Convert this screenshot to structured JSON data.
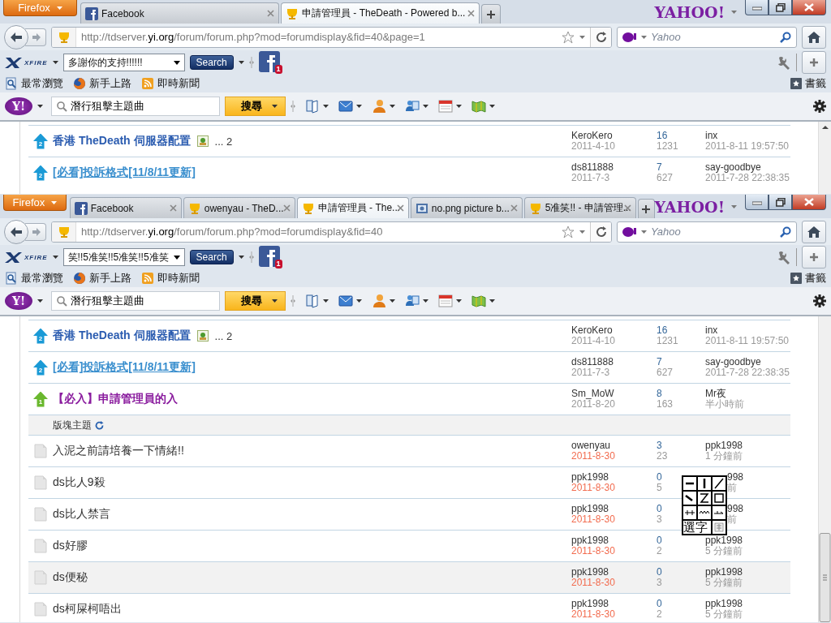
{
  "windows": [
    {
      "menu_button": "Firefox",
      "logo": "YAHOO!",
      "tabs": [
        {
          "kind": "facebook",
          "title": "Facebook",
          "selected": false
        },
        {
          "kind": "trophy",
          "title": "申請管理員 - TheDeath - Powered b...",
          "selected": true
        }
      ],
      "url": "http://tdserver.**yi.org**/forum/forum.php?mod=forumdisplay&fid=40&page=1",
      "web_search_placeholder": "Yahoo",
      "xfire_logo": "XFIRE",
      "xfire_status": "多謝你的支持!!!!!!",
      "xfire_search_button": "Search",
      "notification_count": "1",
      "bookmarks": [
        {
          "kind": "search",
          "label": "最常瀏覽"
        },
        {
          "kind": "firefox",
          "label": "新手上路"
        },
        {
          "kind": "rss",
          "label": "即時新聞"
        }
      ],
      "bookmarks_menu": "書籤",
      "yahoo_logo": "Y!",
      "yahoo_query": "潛行狙擊主題曲",
      "yahoo_search_button": "搜尋",
      "sticky_threads": [
        {
          "kind": "global",
          "badge": "2",
          "title": "香港 TheDeath 伺服器配置",
          "color": "#2b5cb0",
          "underlined": false,
          "has_image": true,
          "pages": "... 2",
          "author": "KeroKero",
          "date": "2011-4-10",
          "date_new": false,
          "replies": "16",
          "views": "1231",
          "last_poster": "inx",
          "last_time": "2011-8-11 19:57:50",
          "highlighted": false
        },
        {
          "kind": "global",
          "badge": "2",
          "title": "[必看]投訴格式[11/8/11更新]",
          "color": "#3a8fce",
          "underlined": true,
          "has_image": false,
          "author": "ds811888",
          "date": "2011-7-3",
          "date_new": false,
          "replies": "7",
          "views": "627",
          "last_poster": "say-goodbye",
          "last_time": "2011-7-28 22:38:35",
          "highlighted": false
        }
      ]
    },
    {
      "menu_button": "Firefox",
      "logo": "YAHOO!",
      "tabs": [
        {
          "kind": "facebook",
          "title": "Facebook",
          "selected": false
        },
        {
          "kind": "trophy",
          "title": "owenyau - TheD...",
          "selected": false
        },
        {
          "kind": "trophy",
          "title": "申請管理員 - The...",
          "selected": true
        },
        {
          "kind": "image",
          "title": "no.png picture b...",
          "selected": false
        },
        {
          "kind": "trophy",
          "title": "5准笑!! - 申請管理...",
          "selected": false
        }
      ],
      "url": "http://tdserver.**yi.org**/forum/forum.php?mod=forumdisplay&fid=40",
      "web_search_placeholder": "Yahoo",
      "xfire_logo": "XFIRE",
      "xfire_status": "笑!!5准笑!!5准笑!!5准笑",
      "xfire_search_button": "Search",
      "notification_count": "1",
      "bookmarks": [
        {
          "kind": "search",
          "label": "最常瀏覽"
        },
        {
          "kind": "firefox",
          "label": "新手上路"
        },
        {
          "kind": "rss",
          "label": "即時新聞"
        }
      ],
      "bookmarks_menu": "書籤",
      "yahoo_logo": "Y!",
      "yahoo_query": "潛行狙擊主題曲",
      "yahoo_search_button": "搜尋",
      "sticky_threads": [
        {
          "kind": "global",
          "badge": "2",
          "title": "香港 TheDeath 伺服器配置",
          "color": "#2b5cb0",
          "underlined": false,
          "has_image": true,
          "pages": "... 2",
          "author": "KeroKero",
          "date": "2011-4-10",
          "date_new": false,
          "replies": "16",
          "views": "1231",
          "last_poster": "inx",
          "last_time": "2011-8-11 19:57:50",
          "highlighted": false
        },
        {
          "kind": "global",
          "badge": "2",
          "title": "[必看]投訴格式[11/8/11更新]",
          "color": "#3a8fce",
          "underlined": true,
          "has_image": false,
          "author": "ds811888",
          "date": "2011-7-3",
          "date_new": false,
          "replies": "7",
          "views": "627",
          "last_poster": "say-goodbye",
          "last_time": "2011-7-28 22:38:35",
          "highlighted": false
        },
        {
          "kind": "category",
          "badge": "1",
          "title": "【必入】申請管理員的入",
          "color": "#8a1c9e",
          "underlined": false,
          "has_image": false,
          "author": "Sm_MoW",
          "date": "2011-8-20",
          "date_new": false,
          "replies": "8",
          "views": "163",
          "last_poster": "Mr夜",
          "last_time": "半小時前",
          "highlighted": false
        }
      ],
      "section_header": "版塊主題",
      "threads": [
        {
          "kind": "normal",
          "title": "入泥之前請培養一下情緒!!",
          "author": "owenyau",
          "date": "2011-8-30",
          "date_new": true,
          "replies": "3",
          "views": "23",
          "last_poster": "ppk1998",
          "last_time": "1 分鐘前",
          "highlighted": false,
          "covered": false
        },
        {
          "kind": "normal",
          "title": "ds比人9殺",
          "author": "ppk1998",
          "date": "2011-8-30",
          "date_new": true,
          "replies": "0",
          "views": "5",
          "last_poster": "998",
          "last_time": "前",
          "highlighted": false,
          "covered": true
        },
        {
          "kind": "normal",
          "title": "ds比人禁言",
          "author": "ppk1998",
          "date": "2011-8-30",
          "date_new": true,
          "replies": "0",
          "views": "3",
          "last_poster": "998",
          "last_time": "前",
          "highlighted": false,
          "covered": true
        },
        {
          "kind": "normal",
          "title": "ds好膠",
          "author": "ppk1998",
          "date": "2011-8-30",
          "date_new": true,
          "replies": "0",
          "views": "2",
          "last_poster": "ppk1998",
          "last_time": "5 分鐘前",
          "highlighted": false,
          "covered": false
        },
        {
          "kind": "normal",
          "title": "ds便秘",
          "author": "ppk1998",
          "date": "2011-8-30",
          "date_new": true,
          "replies": "0",
          "views": "3",
          "last_poster": "ppk1998",
          "last_time": "5 分鐘前",
          "highlighted": true,
          "covered": false
        },
        {
          "kind": "normal",
          "title": "ds柯屎柯唔出",
          "author": "ppk1998",
          "date": "2011-8-30",
          "date_new": true,
          "replies": "0",
          "views": "2",
          "last_poster": "ppk1998",
          "last_time": "5 分鐘前",
          "highlighted": false,
          "covered": false
        }
      ],
      "ime_pad": {
        "select_button": "選字"
      }
    }
  ]
}
